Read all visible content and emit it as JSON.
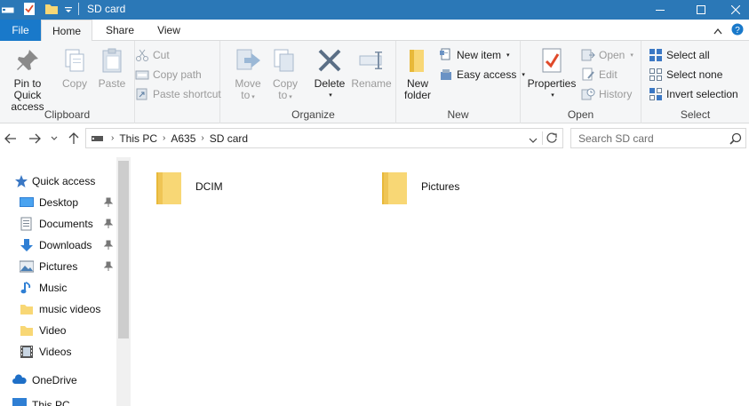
{
  "window": {
    "title": "SD card"
  },
  "ribbon_tabs": [
    "File",
    "Home",
    "Share",
    "View"
  ],
  "clipboard": {
    "group_label": "Clipboard",
    "pin_label_1": "Pin to Quick",
    "pin_label_2": "access",
    "copy": "Copy",
    "paste": "Paste",
    "cut": "Cut",
    "copy_path": "Copy path",
    "paste_shortcut": "Paste shortcut"
  },
  "organize": {
    "group_label": "Organize",
    "move_to_1": "Move",
    "move_to_2": "to",
    "copy_to_1": "Copy",
    "copy_to_2": "to",
    "delete": "Delete",
    "rename": "Rename"
  },
  "new": {
    "group_label": "New",
    "new_folder_1": "New",
    "new_folder_2": "folder",
    "new_item": "New item",
    "easy_access": "Easy access"
  },
  "open": {
    "group_label": "Open",
    "properties": "Properties",
    "open": "Open",
    "edit": "Edit",
    "history": "History"
  },
  "select": {
    "group_label": "Select",
    "select_all": "Select all",
    "select_none": "Select none",
    "invert_selection": "Invert selection"
  },
  "address": {
    "crumbs": [
      "This PC",
      "A635",
      "SD card"
    ]
  },
  "search": {
    "placeholder": "Search SD card"
  },
  "nav_pane": {
    "quick_access": "Quick access",
    "items": [
      "Desktop",
      "Documents",
      "Downloads",
      "Pictures",
      "Music",
      "music videos",
      "Video",
      "Videos"
    ],
    "onedrive": "OneDrive",
    "this_pc": "This PC"
  },
  "files": [
    "DCIM",
    "Pictures"
  ],
  "colors": {
    "titlebar": "#2b78b7",
    "file_tab": "#1979ca",
    "ribbon_bg": "#f5f6f7",
    "folder_yellow": "#f8d775"
  }
}
